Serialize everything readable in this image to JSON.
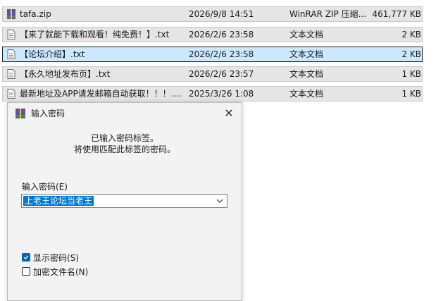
{
  "files": [
    {
      "name": "tafa.zip",
      "date": "2026/9/8 14:51",
      "type": "WinRAR ZIP 压缩...",
      "size": "461,777 KB",
      "icon": "zip-archive-icon",
      "selected": false
    },
    {
      "name": "【来了就能下载和观看！纯免费！】.txt",
      "date": "2026/2/6 23:58",
      "type": "文本文档",
      "size": "2 KB",
      "icon": "text-file-icon",
      "selected": false
    },
    {
      "name": "【论坛介绍】.txt",
      "date": "2026/2/6 23:58",
      "type": "文本文档",
      "size": "2 KB",
      "icon": "text-file-icon",
      "selected": true
    },
    {
      "name": "【永久地址发布页】.txt",
      "date": "2026/2/6 23:57",
      "type": "文本文档",
      "size": "1 KB",
      "icon": "text-file-icon",
      "selected": false
    },
    {
      "name": "最新地址及APP请发邮箱自动获取！！！....",
      "date": "2025/3/26 1:08",
      "type": "文本文档",
      "size": "1 KB",
      "icon": "text-file-icon",
      "selected": false
    }
  ],
  "dialog": {
    "title": "输入密码",
    "info_line1": "已输入密码标签。",
    "info_line2": "将使用匹配此标签的密码。",
    "password_label": "输入密码(E)",
    "password_value": "上老王论坛当老王",
    "show_password_label": "显示密码(S)",
    "show_password_checked": true,
    "encrypt_names_label": "加密文件名(N)",
    "encrypt_names_checked": false,
    "close_glyph": "✕"
  },
  "colors": {
    "row_bg": "#e5e5e5",
    "selected_bg": "#cce8ff",
    "accent": "#0078d7",
    "checkbox_on": "#0067c0"
  }
}
